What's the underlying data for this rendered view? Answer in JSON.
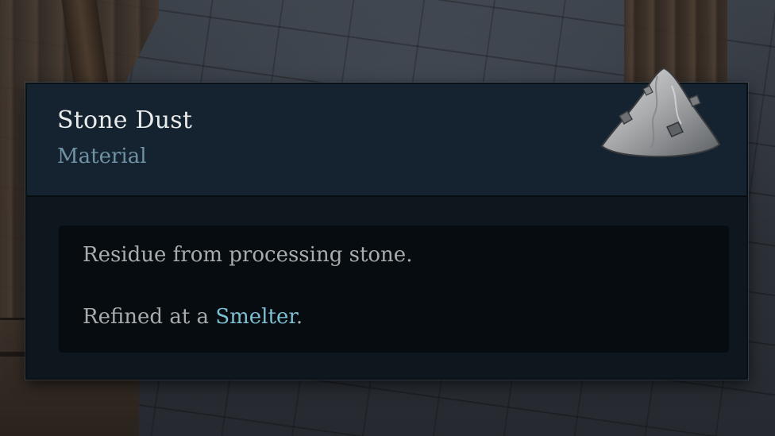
{
  "item": {
    "name": "Stone Dust",
    "type": "Material",
    "icon": "stone-dust-pile-icon"
  },
  "description": {
    "line1": "Residue from processing stone.",
    "line2_prefix": "Refined at a ",
    "line2_link": "Smelter",
    "line2_suffix": "."
  },
  "colors": {
    "name": "#e9eaea",
    "type": "#6f93a4",
    "body_text": "#a8acad",
    "link": "#7ec0d3",
    "header_bg": "#14232f",
    "panel_bg": "#0f1920",
    "desc_bg": "#060c10"
  }
}
